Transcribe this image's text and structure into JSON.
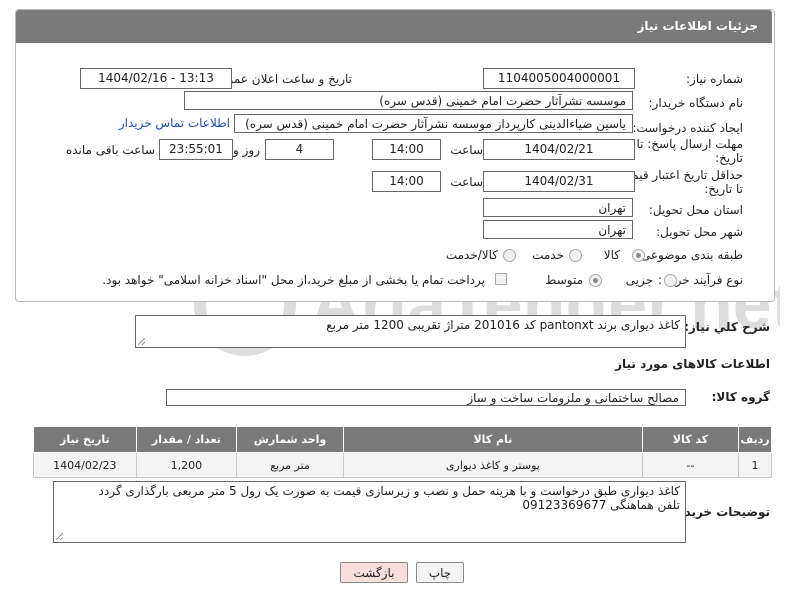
{
  "header": {
    "title": "جزئیات اطلاعات نیاز"
  },
  "form": {
    "need_number_label": "شماره نیاز:",
    "need_number": "1104005004000001",
    "announce_label": "تاریخ و ساعت اعلان عمومی:",
    "announce_value": "1404/02/16 - 13:13",
    "buyer_org_label": "نام دستگاه خریدار:",
    "buyer_org": "موسسه نشرآثار حضرت امام خمینی (قدس سره)",
    "requester_label": "ایجاد کننده درخواست:",
    "requester": "یاسین ضیاءالدینی کارپرداز موسسه نشرآثار حضرت امام خمینی (قدس سره)",
    "contact_link": "اطلاعات تماس خریدار",
    "deadline_label": "مهلت ارسال پاسخ: تا تاریخ:",
    "deadline_date": "1404/02/21",
    "time_label": "ساعت",
    "deadline_time": "14:00",
    "days": "4",
    "days_label": "روز و",
    "remaining_time": "23:55:01",
    "remaining_label": "ساعت باقی مانده",
    "validity_label": "حداقل تاریخ اعتبار قیمت: تا تاریخ:",
    "validity_date": "1404/02/31",
    "validity_time": "14:00",
    "province_label": "استان محل تحویل:",
    "province": "تهران",
    "city_label": "شهر محل تحویل:",
    "city": "تهران",
    "category_label": "طبقه بندی موضوعی:",
    "category_options": [
      "کالا",
      "خدمت",
      "کالا/خدمت"
    ],
    "category_selected": "کالا",
    "process_label": "نوع فرآیند خرید :",
    "process_options": [
      "جزیی",
      "متوسط"
    ],
    "process_selected": "متوسط",
    "payment_note": "پرداخت تمام یا بخشی از مبلغ خرید،از محل \"اسناد خزانه اسلامی\" خواهد بود."
  },
  "description": {
    "label": "شرح کلي نياز:",
    "value": "کاغذ دیواری برند pantonxt کد 201016 متراژ تقریبی 1200 متر مربع"
  },
  "goods": {
    "section_title": "اطلاعات کالاهای مورد نیاز",
    "group_label": "گروه کالا:",
    "group_value": "مصالح ساختمانی و ملزومات ساخت و ساز",
    "columns": [
      "ردیف",
      "کد کالا",
      "نام کالا",
      "واحد شمارش",
      "تعداد / مقدار",
      "تاریخ نیاز"
    ],
    "rows": [
      [
        "1",
        "--",
        "پوستر و کاغذ دیواری",
        "متر مربع",
        "1,200",
        "1404/02/23"
      ]
    ]
  },
  "buyer_notes": {
    "label": "توضیحات خریدار:",
    "line1": "کاغذ دیواری طبق درخواست و با هزینه حمل و نصب و زیرسازی قیمت به صورت یک رول 5 متر مربعی بارگذاری گردد",
    "line2": "تلفن هماهنگی 09123369677"
  },
  "buttons": {
    "print": "چاپ",
    "back": "بازگشت"
  },
  "colors": {
    "header_bg": "#7a7a7a",
    "link": "#1f4fb0",
    "back_button_bg": "#f9dede"
  }
}
